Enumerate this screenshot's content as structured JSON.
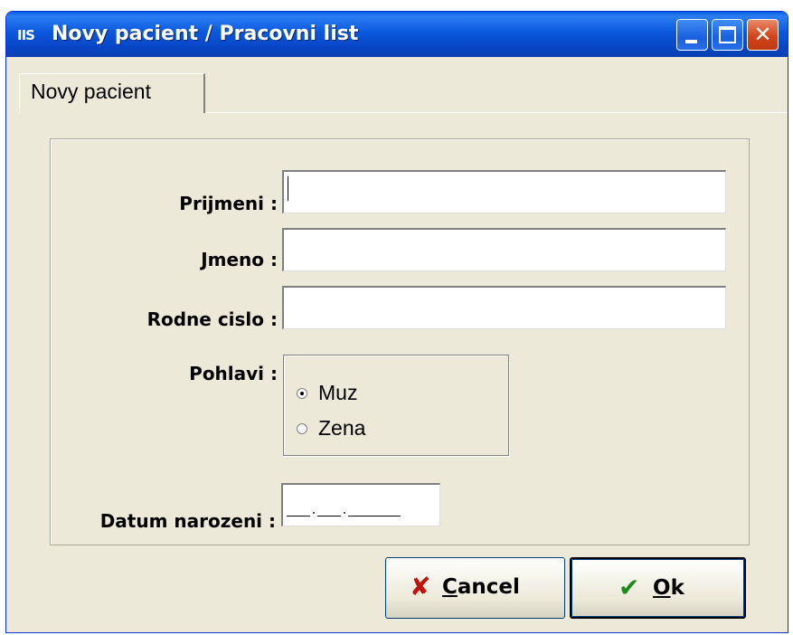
{
  "window": {
    "app_icon_text": "IIS",
    "title": "Novy pacient / Pracovni list",
    "buttons": {
      "minimize": "minimize",
      "maximize": "maximize",
      "close": "close"
    }
  },
  "tabs": [
    {
      "label": "Novy pacient",
      "active": true
    }
  ],
  "form": {
    "surname_label": "Prijmeni :",
    "surname_value": "",
    "firstname_label": "Jmeno :",
    "firstname_value": "",
    "birthnumber_label": "Rodne cislo  :",
    "birthnumber_value": "",
    "sex_label": "Pohlavi :",
    "sex_options": [
      {
        "label": "Muz",
        "selected": true
      },
      {
        "label": "Zena",
        "selected": false
      }
    ],
    "birthdate_label": "Datum narozeni :",
    "birthdate_value": ""
  },
  "actions": {
    "cancel_mnemonic": "C",
    "cancel_rest": "ancel",
    "cancel_icon": "cross-icon",
    "ok_mnemonic": "O",
    "ok_rest": "k",
    "ok_icon": "checkmark-icon"
  },
  "colors": {
    "titlebar": "#0b58de",
    "window_bg": "#ece9d8",
    "cancel_icon": "#c0120c",
    "ok_icon": "#1c8a1c"
  }
}
